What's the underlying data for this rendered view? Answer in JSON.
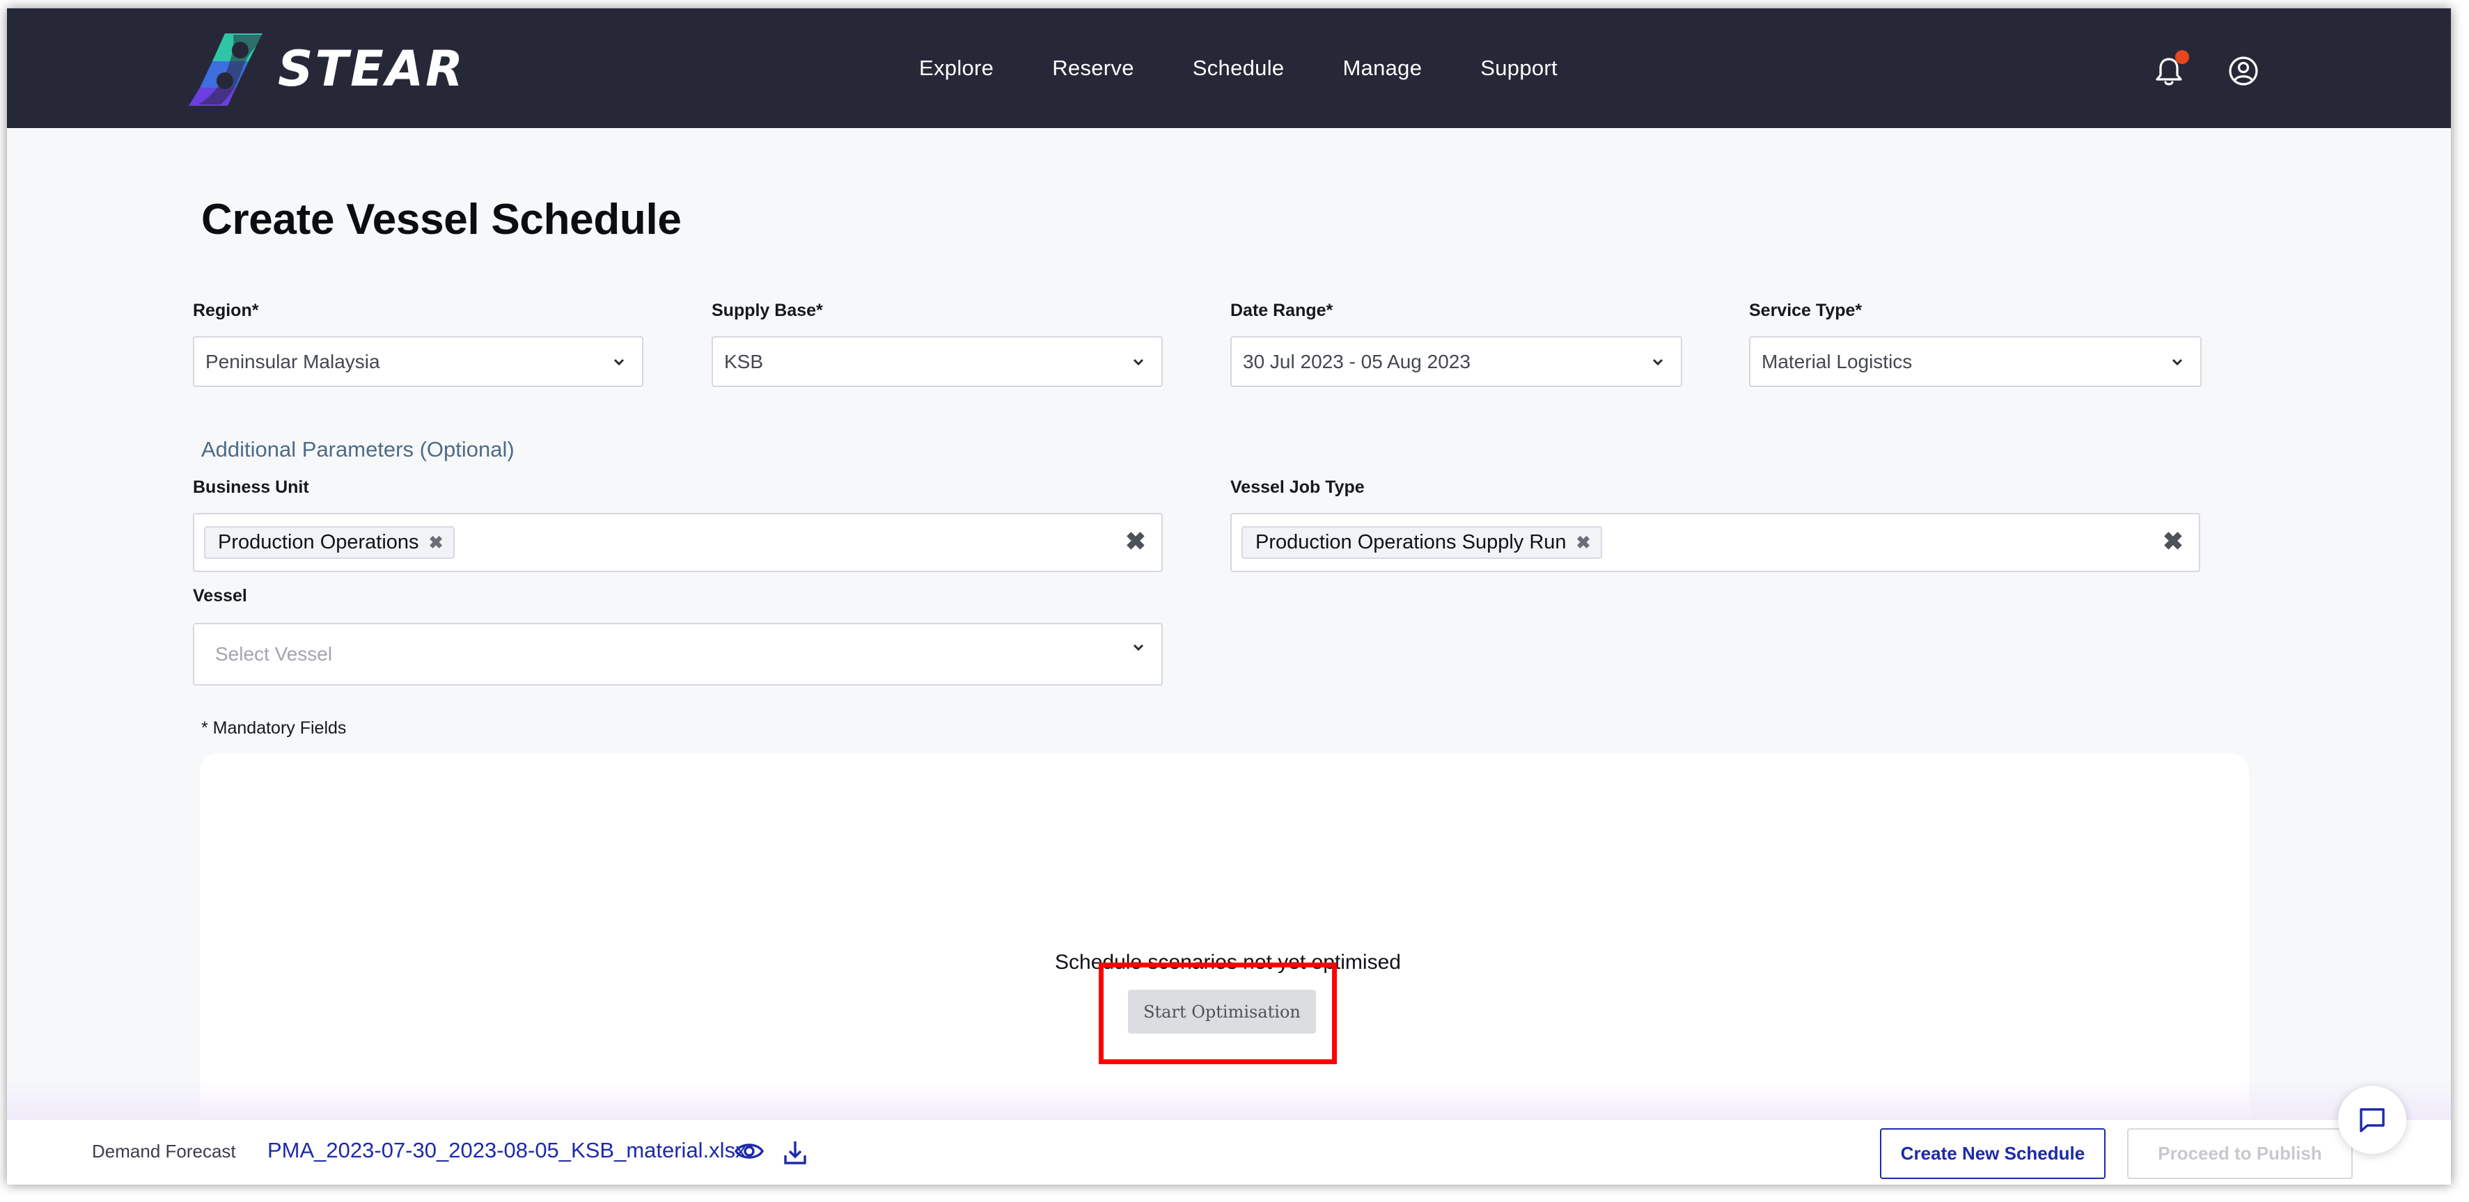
{
  "brand": {
    "name": "STEAR",
    "logo_colors": [
      "#3d6ee0",
      "#2fc6a8",
      "#6b3fe0"
    ]
  },
  "nav": {
    "items": [
      "Explore",
      "Reserve",
      "Schedule",
      "Manage",
      "Support"
    ]
  },
  "header_icons": {
    "notification": "bell-icon",
    "notification_dot_color": "#e8461b",
    "account": "user-circle-icon"
  },
  "page": {
    "title": "Create Vessel Schedule"
  },
  "form": {
    "region": {
      "label": "Region*",
      "value": "Peninsular Malaysia"
    },
    "supply_base": {
      "label": "Supply Base*",
      "value": "KSB"
    },
    "date_range": {
      "label": "Date Range*",
      "value": "30 Jul 2023 - 05 Aug 2023"
    },
    "service_type": {
      "label": "Service Type*",
      "value": "Material Logistics"
    },
    "additional_heading": "Additional Parameters (Optional)",
    "business_unit": {
      "label": "Business Unit",
      "tags": [
        "Production Operations"
      ]
    },
    "vessel_job_type": {
      "label": "Vessel Job Type",
      "tags": [
        "Production Operations Supply Run"
      ]
    },
    "vessel": {
      "label": "Vessel",
      "placeholder": "Select Vessel"
    },
    "mandatory_note": "* Mandatory Fields"
  },
  "scenario": {
    "empty_message": "Schedule scenarios not yet optimised",
    "start_button": "Start Optimisation",
    "highlight_color": "#ff0000"
  },
  "footer": {
    "demand_label": "Demand Forecast",
    "file_name": "PMA_2023-07-30_2023-08-05_KSB_material.xlsx",
    "create_button": "Create New Schedule",
    "publish_button": "Proceed to Publish",
    "accent_color": "#1d2aa8"
  },
  "chat_icon": "chat-icon"
}
